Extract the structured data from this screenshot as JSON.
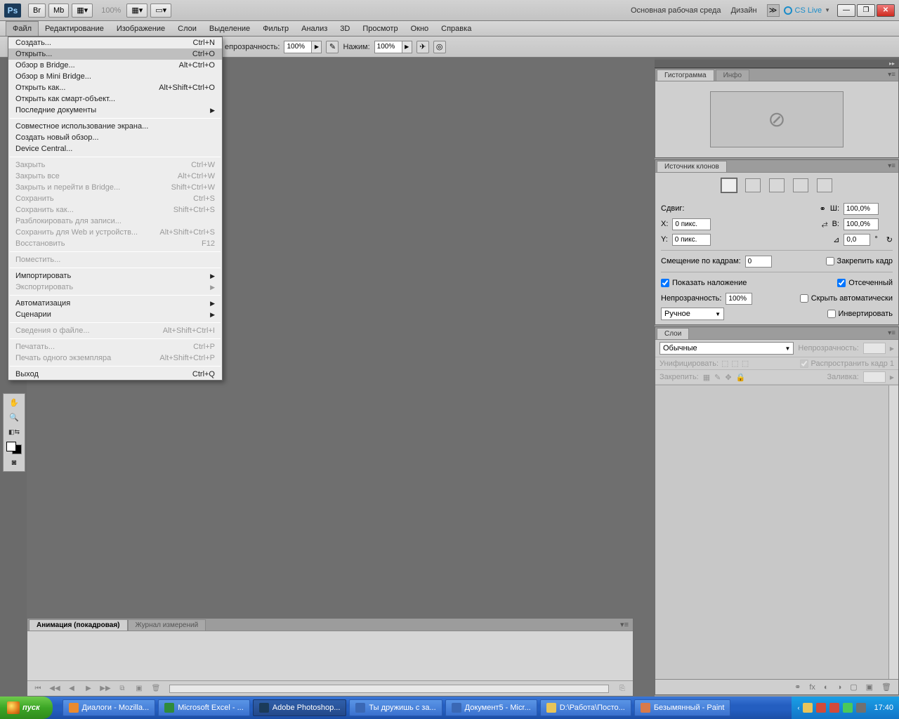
{
  "appbar": {
    "ps_label": "Ps",
    "zoom": "100%",
    "workspace": "Основная рабочая среда",
    "design": "Дизайн",
    "cslive": "CS Live"
  },
  "menubar": [
    "Файл",
    "Редактирование",
    "Изображение",
    "Слои",
    "Выделение",
    "Фильтр",
    "Анализ",
    "3D",
    "Просмотр",
    "Окно",
    "Справка"
  ],
  "optbar": {
    "opacity_label": "епрозрачность:",
    "opacity_value": "100%",
    "flow_label": "Нажим:",
    "flow_value": "100%"
  },
  "file_menu": [
    {
      "t": "Создать...",
      "s": "Ctrl+N"
    },
    {
      "t": "Открыть...",
      "s": "Ctrl+O",
      "hover": true
    },
    {
      "t": "Обзор в Bridge...",
      "s": "Alt+Ctrl+O"
    },
    {
      "t": "Обзор в Mini Bridge..."
    },
    {
      "t": "Открыть как...",
      "s": "Alt+Shift+Ctrl+O"
    },
    {
      "t": "Открыть как смарт-объект..."
    },
    {
      "t": "Последние документы",
      "sub": true
    },
    {
      "sep": true
    },
    {
      "t": "Совместное использование экрана..."
    },
    {
      "t": "Создать новый обзор..."
    },
    {
      "t": "Device Central..."
    },
    {
      "sep": true
    },
    {
      "t": "Закрыть",
      "s": "Ctrl+W",
      "d": true
    },
    {
      "t": "Закрыть все",
      "s": "Alt+Ctrl+W",
      "d": true
    },
    {
      "t": "Закрыть и перейти в Bridge...",
      "s": "Shift+Ctrl+W",
      "d": true
    },
    {
      "t": "Сохранить",
      "s": "Ctrl+S",
      "d": true
    },
    {
      "t": "Сохранить как...",
      "s": "Shift+Ctrl+S",
      "d": true
    },
    {
      "t": "Разблокировать для записи...",
      "d": true
    },
    {
      "t": "Сохранить для Web и устройств...",
      "s": "Alt+Shift+Ctrl+S",
      "d": true
    },
    {
      "t": "Восстановить",
      "s": "F12",
      "d": true
    },
    {
      "sep": true
    },
    {
      "t": "Поместить...",
      "d": true
    },
    {
      "sep": true
    },
    {
      "t": "Импортировать",
      "sub": true
    },
    {
      "t": "Экспортировать",
      "sub": true,
      "d": true
    },
    {
      "sep": true
    },
    {
      "t": "Автоматизация",
      "sub": true
    },
    {
      "t": "Сценарии",
      "sub": true
    },
    {
      "sep": true
    },
    {
      "t": "Сведения о файле...",
      "s": "Alt+Shift+Ctrl+I",
      "d": true
    },
    {
      "sep": true
    },
    {
      "t": "Печатать...",
      "s": "Ctrl+P",
      "d": true
    },
    {
      "t": "Печать одного экземпляра",
      "s": "Alt+Shift+Ctrl+P",
      "d": true
    },
    {
      "sep": true
    },
    {
      "t": "Выход",
      "s": "Ctrl+Q"
    }
  ],
  "panels": {
    "histogram_tab": "Гистограмма",
    "info_tab": "Инфо",
    "clone_tab": "Источник клонов",
    "clone": {
      "shift": "Сдвиг:",
      "x": "X:",
      "x_val": "0 пикс.",
      "y": "Y:",
      "y_val": "0 пикс.",
      "w": "Ш:",
      "w_val": "100,0%",
      "h": "В:",
      "h_val": "100,0%",
      "angle_val": "0,0",
      "frame_offset": "Смещение по кадрам:",
      "frame_val": "0",
      "lock_frame": "Закрепить кадр",
      "show_overlay": "Показать наложение",
      "clipped": "Отсеченный",
      "opacity": "Непрозрачность:",
      "opacity_val": "100%",
      "autohide": "Скрыть автоматически",
      "mode": "Ручное",
      "invert": "Инвертировать"
    },
    "layers_tab": "Слои",
    "layers": {
      "blend": "Обычные",
      "opacity_lbl": "Непрозрачность:",
      "unify": "Унифицировать:",
      "propagate": "Распространить кадр 1",
      "lock": "Закрепить:",
      "fill": "Заливка:"
    },
    "anim_tab": "Анимация (покадровая)",
    "measure_tab": "Журнал измерений"
  },
  "taskbar": {
    "start": "пуск",
    "tasks": [
      {
        "t": "Диалоги - Mozilla...",
        "ic": "#e98a2f"
      },
      {
        "t": "Microsoft Excel - ...",
        "ic": "#2f8b3c"
      },
      {
        "t": "Adobe Photoshop...",
        "ic": "#1b3b5a",
        "active": true
      },
      {
        "t": "Ты дружишь с за...",
        "ic": "#3a68b5"
      },
      {
        "t": "Документ5 - Micr...",
        "ic": "#3a68b5"
      },
      {
        "t": "D:\\Работа\\Посто...",
        "ic": "#e8c55a"
      },
      {
        "t": "Безымянный - Paint",
        "ic": "#d87a4a"
      }
    ],
    "clock": "17:40"
  }
}
